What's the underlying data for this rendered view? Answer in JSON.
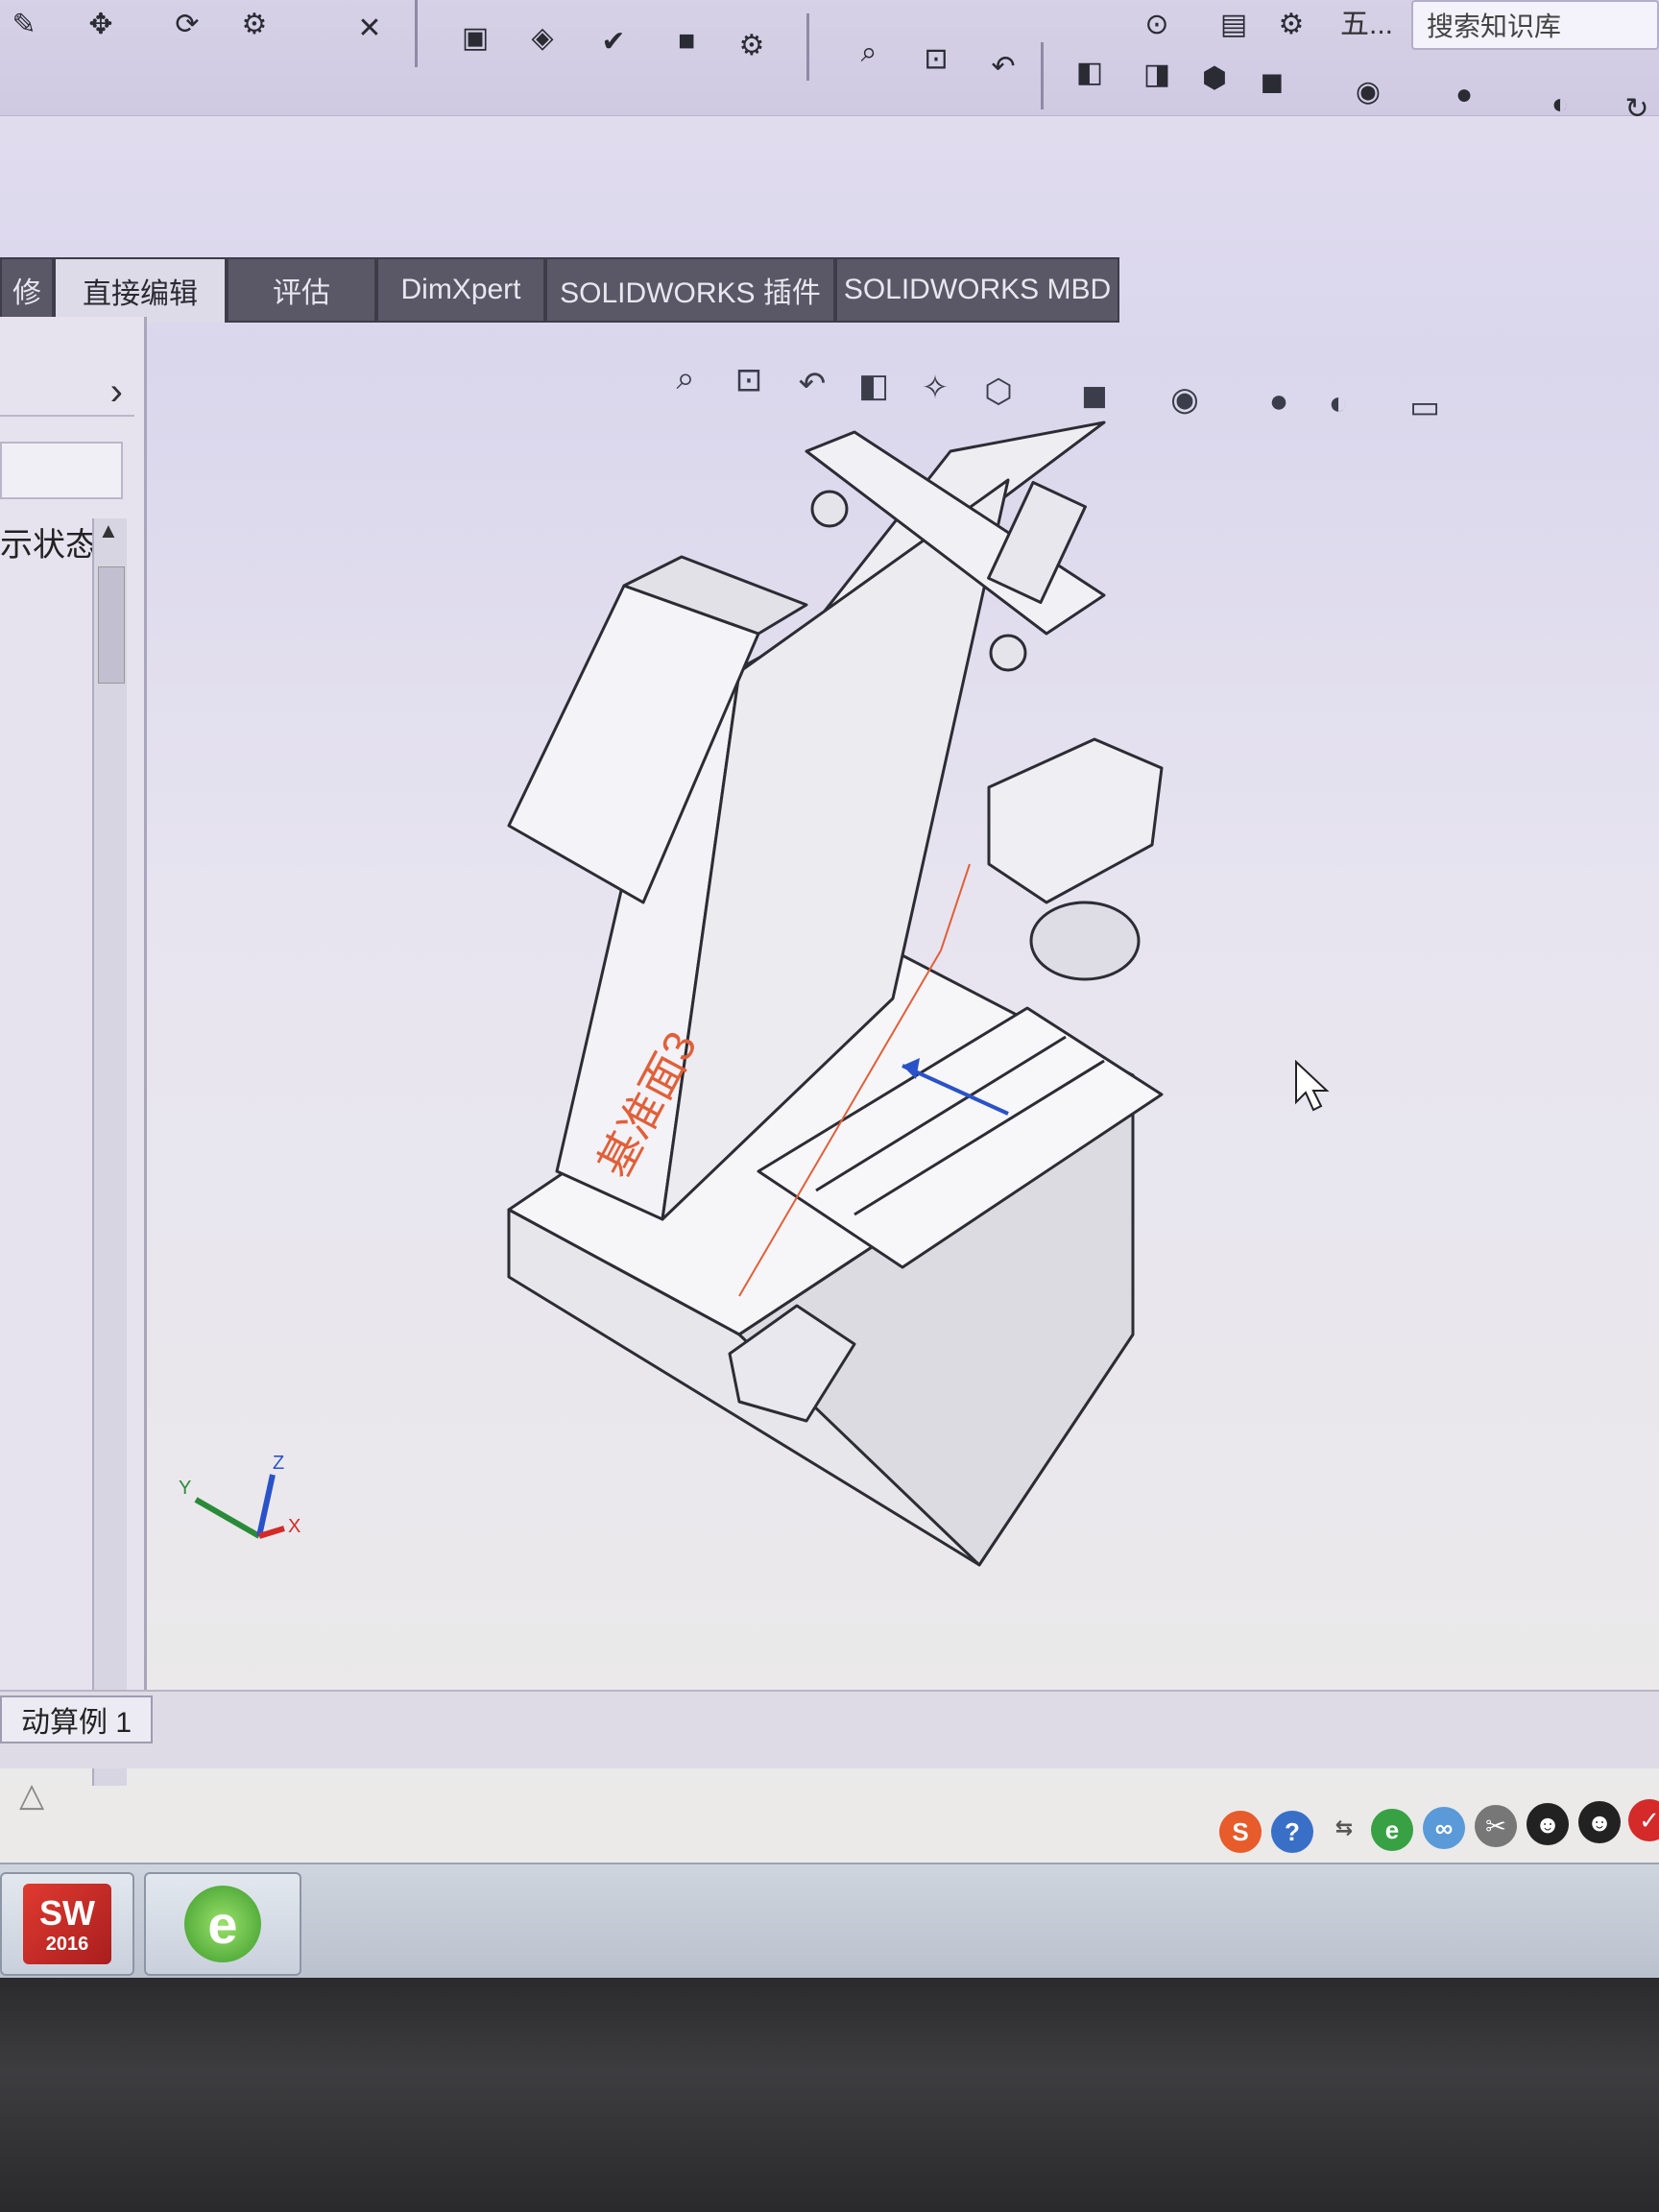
{
  "toolbar": {
    "search_placeholder": "搜索知识库",
    "view_menu_label": "五..."
  },
  "tabs": [
    {
      "label": "修"
    },
    {
      "label": "直接编辑"
    },
    {
      "label": "评估"
    },
    {
      "label": "DimXpert"
    },
    {
      "label": "SOLIDWORKS 插件"
    },
    {
      "label": "SOLIDWORKS MBD"
    }
  ],
  "left_panel": {
    "display_state_label": "示状态",
    "expand_arrow": "›"
  },
  "viewport": {
    "part_label": "基准面3",
    "triad_x": "X",
    "triad_y": "Y",
    "triad_z": "Z"
  },
  "status": {
    "motion_study_tab": "动算例 1"
  },
  "taskbar": {
    "sw_icon_text": "SW",
    "sw_year": "2016"
  },
  "tray": {
    "sogou": "S",
    "help": "?"
  },
  "colors": {
    "accent_orange": "#e0603a",
    "triad_red": "#d42a2a",
    "triad_green": "#2a8a3a",
    "triad_blue": "#2a52c8"
  }
}
